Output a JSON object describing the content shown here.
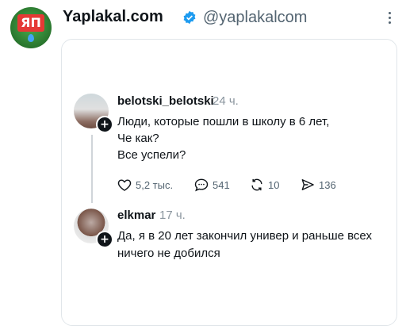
{
  "account": {
    "display_name": "Yaplakal.com",
    "handle": "@yaplakalcom",
    "avatar_text": "ЯП",
    "verified": true
  },
  "post": {
    "author": "belotski_belotski",
    "time": "24 ч.",
    "lines": [
      "Люди, которые пошли в школу в 6 лет,",
      "Че как?",
      "Все успели?"
    ],
    "likes": "5,2 тыс.",
    "replies": "541",
    "reposts": "10",
    "shares": "136"
  },
  "reply": {
    "author": "elkmar",
    "time": "17 ч.",
    "lines": [
      "Да, я в 20 лет закончил универ и раньше всех",
      "ничего не добился"
    ]
  },
  "icons": {
    "verified": "verified-badge-icon",
    "more": "more-icon",
    "like": "heart-icon",
    "reply": "comment-icon",
    "repost": "repost-icon",
    "share": "share-icon",
    "follow": "plus-icon"
  },
  "colors": {
    "text": "#0f1419",
    "muted": "#8a959e",
    "verified": "#1d9bf0",
    "border": "#e1e6ea"
  }
}
